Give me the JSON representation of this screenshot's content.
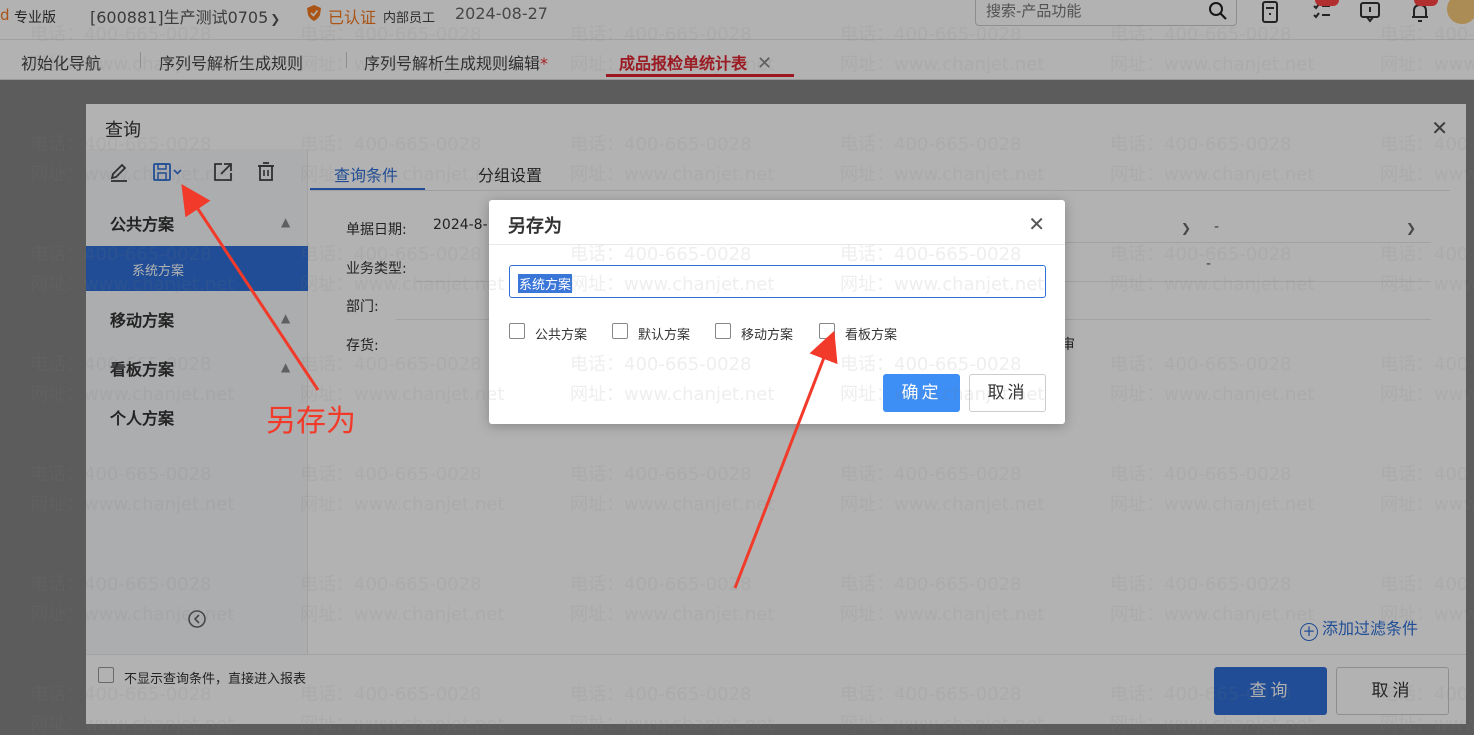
{
  "topbar": {
    "logo_char": "d",
    "edition": "专业版",
    "account": "[600881]生产测试0705",
    "certified": "已认证",
    "staff": "内部员工",
    "date": "2024-08-27",
    "search_placeholder": "搜索-产品功能"
  },
  "tabs": [
    {
      "label": "初始化导航"
    },
    {
      "label": "序列号解析生成规则"
    },
    {
      "label": "序列号解析生成规则编辑",
      "modified": "*"
    },
    {
      "label": "成品报检单统计表",
      "close": "✕"
    }
  ],
  "query_dialog": {
    "title": "查询",
    "close": "✕",
    "sidebar": {
      "public": "公共方案",
      "system": "系统方案",
      "mobile": "移动方案",
      "board": "看板方案",
      "personal": "个人方案"
    },
    "tabs": [
      "查询条件",
      "分组设置"
    ],
    "fields": {
      "date_label": "单据日期:",
      "date_value": "2024-8-",
      "biz_type": "业务类型:",
      "dept": "部门:",
      "stock": "存货:",
      "shen_fragment": "审",
      "dash": "-"
    },
    "add_filter": "添加过滤条件",
    "skip_label": "不显示查询条件，直接进入报表",
    "query_button": "查询",
    "cancel_button": "取消"
  },
  "save_as_dialog": {
    "title": "另存为",
    "close": "✕",
    "name_value": "系统方案",
    "options": [
      {
        "label": "公共方案",
        "checked": false
      },
      {
        "label": "默认方案",
        "checked": false
      },
      {
        "label": "移动方案",
        "checked": false
      },
      {
        "label": "看板方案",
        "checked": false
      }
    ],
    "ok": "确定",
    "cancel": "取消"
  },
  "annotation": "另存为",
  "watermark": {
    "phone": "电话：400-665-0028",
    "site": "网址：www.chanjet.net"
  },
  "colors": {
    "accent_red": "#e0232e",
    "primary_blue": "#2f6fd6",
    "ok_blue": "#3d8ef5",
    "cert_orange": "#f47a20",
    "annotation_red": "#f23a2a"
  }
}
